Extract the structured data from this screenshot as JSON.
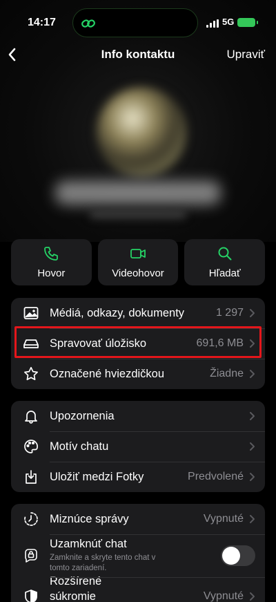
{
  "status_bar": {
    "time": "14:17",
    "network": "5G",
    "icons": [
      "link-icon",
      "signal-icon",
      "battery-charging-icon"
    ]
  },
  "nav": {
    "title": "Info kontaktu",
    "edit_label": "Upraviť",
    "back_icon": "chevron-left-icon"
  },
  "actions": [
    {
      "label": "Hovor",
      "icon": "phone-icon"
    },
    {
      "label": "Videohovor",
      "icon": "video-icon"
    },
    {
      "label": "Hľadať",
      "icon": "search-icon"
    }
  ],
  "group1": [
    {
      "label": "Médiá, odkazy, dokumenty",
      "value": "1 297",
      "icon": "photo-icon"
    },
    {
      "label": "Spravovať úložisko",
      "value": "691,6 MB",
      "icon": "storage-icon"
    },
    {
      "label": "Označené hviezdičkou",
      "value": "Žiadne",
      "icon": "star-icon"
    }
  ],
  "group2": [
    {
      "label": "Upozornenia",
      "value": "",
      "icon": "bell-icon"
    },
    {
      "label": "Motív chatu",
      "value": "",
      "icon": "palette-icon"
    },
    {
      "label": "Uložiť medzi Fotky",
      "value": "Predvolené",
      "icon": "download-icon"
    }
  ],
  "group3": {
    "disappearing": {
      "label": "Miznúce správy",
      "value": "Vypnuté",
      "icon": "timer-icon"
    },
    "lock": {
      "label": "Uzamknúť chat",
      "sublabel": "Zamknite a skryte tento chat v tomto zariadení.",
      "toggle_on": false,
      "icon": "lock-chat-icon"
    },
    "privacy": {
      "label": "Rozšírené súkromie chatov",
      "value": "Vypnuté",
      "icon": "shield-icon"
    }
  },
  "colors": {
    "accent_green": "#25d366",
    "highlight_red": "#e4161b",
    "cell_bg": "#1c1c1e"
  }
}
